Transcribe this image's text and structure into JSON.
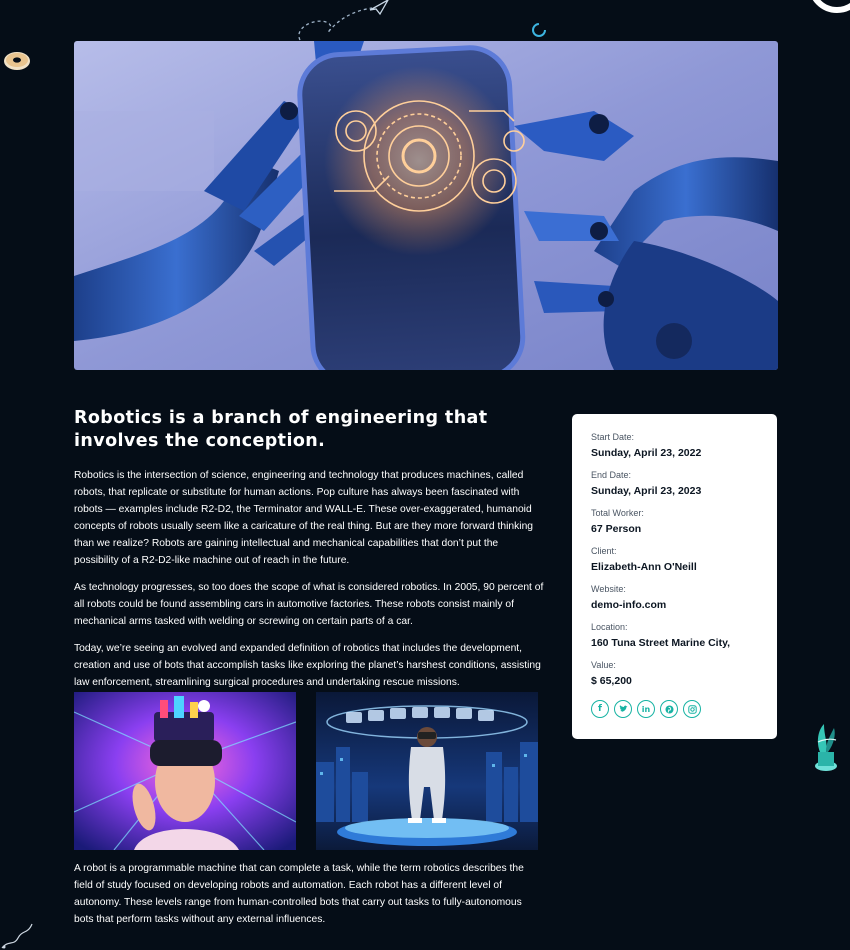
{
  "article": {
    "title": "Robotics is a branch of engineering that involves the conception.",
    "paragraphs": [
      "Robotics is the intersection of science, engineering and technology that produces machines, called robots, that replicate or substitute for human actions. Pop culture has always been fascinated with robots — examples include R2-D2, the Terminator and WALL-E. These over-exaggerated, humanoid concepts of robots usually seem like a caricature of the real thing. But are they more forward thinking than we realize? Robots are gaining intellectual and mechanical capabilities that don’t put the possibility of a R2-D2-like machine out of reach in the future.",
      "As technology progresses, so too does the scope of what is considered robotics. In 2005, 90 percent of all robots could be found assembling cars in automotive factories. These robots consist mainly of mechanical arms tasked with welding or screwing on certain parts of a car.",
      "Today, we’re seeing an evolved and expanded definition of robotics that includes the development, creation and use of bots that accomplish tasks like exploring the planet’s harshest conditions, assisting law enforcement, streamlining surgical procedures and undertaking rescue missions."
    ],
    "closing": "A robot is a programmable machine that can complete a task, while the term robotics describes the field of study focused on developing robots and automation. Each robot has a different level of autonomy. These levels range from human-controlled bots that carry out tasks to fully-autonomous bots that perform tasks without any external influences."
  },
  "info": {
    "start_label": "Start Date:",
    "start_value": "Sunday, April 23, 2022",
    "end_label": "End Date:",
    "end_value": "Sunday, April 23, 2023",
    "worker_label": "Total Worker:",
    "worker_value": "67 Person",
    "client_label": "Client:",
    "client_value": "Elizabeth-Ann O'Neill",
    "website_label": "Website:",
    "website_value": "demo-info.com",
    "location_label": "Location:",
    "location_value": "160 Tuna Street Marine City,",
    "value_label": "Value:",
    "value_value": "$ 65,200"
  },
  "social_icons": [
    "facebook-icon",
    "twitter-icon",
    "linkedin-icon",
    "pinterest-icon",
    "instagram-icon"
  ],
  "colors": {
    "background": "#050d17",
    "card": "#ffffff",
    "accent": "#17b3a3",
    "text": "#ffffff"
  }
}
